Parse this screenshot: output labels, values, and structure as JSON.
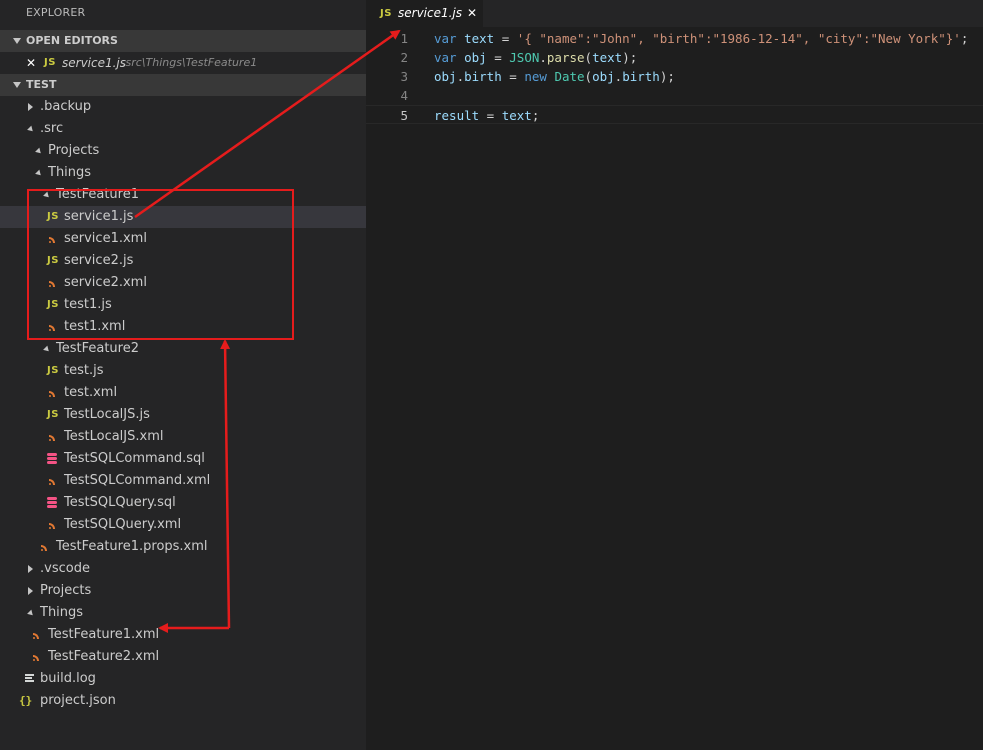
{
  "explorer": {
    "title": "EXPLORER",
    "open_editors": {
      "header": "OPEN EDITORS",
      "items": [
        {
          "icon": "JS",
          "name": "service1.js",
          "path": ".src\\Things\\TestFeature1",
          "close": "✕"
        }
      ]
    },
    "project": {
      "header": "TEST",
      "tree": [
        {
          "label": ".backup",
          "type": "folder",
          "state": "closed",
          "depth": 1
        },
        {
          "label": ".src",
          "type": "folder",
          "state": "open",
          "depth": 1
        },
        {
          "label": "Projects",
          "type": "folder",
          "state": "open",
          "depth": 2
        },
        {
          "label": "Things",
          "type": "folder",
          "state": "open",
          "depth": 2
        },
        {
          "label": "TestFeature1",
          "type": "folder",
          "state": "open",
          "depth": 3
        },
        {
          "label": "service1.js",
          "type": "js",
          "depth": 4,
          "selected": true
        },
        {
          "label": "service1.xml",
          "type": "xml",
          "depth": 4
        },
        {
          "label": "service2.js",
          "type": "js",
          "depth": 4
        },
        {
          "label": "service2.xml",
          "type": "xml",
          "depth": 4
        },
        {
          "label": "test1.js",
          "type": "js",
          "depth": 4
        },
        {
          "label": "test1.xml",
          "type": "xml",
          "depth": 4
        },
        {
          "label": "TestFeature2",
          "type": "folder",
          "state": "open",
          "depth": 3
        },
        {
          "label": "test.js",
          "type": "js",
          "depth": 4
        },
        {
          "label": "test.xml",
          "type": "xml",
          "depth": 4
        },
        {
          "label": "TestLocalJS.js",
          "type": "js",
          "depth": 4
        },
        {
          "label": "TestLocalJS.xml",
          "type": "xml",
          "depth": 4
        },
        {
          "label": "TestSQLCommand.sql",
          "type": "sql",
          "depth": 4
        },
        {
          "label": "TestSQLCommand.xml",
          "type": "xml",
          "depth": 4
        },
        {
          "label": "TestSQLQuery.sql",
          "type": "sql",
          "depth": 4
        },
        {
          "label": "TestSQLQuery.xml",
          "type": "xml",
          "depth": 4
        },
        {
          "label": "TestFeature1.props.xml",
          "type": "xml",
          "depth": 3
        },
        {
          "label": ".vscode",
          "type": "folder",
          "state": "closed",
          "depth": 1
        },
        {
          "label": "Projects",
          "type": "folder",
          "state": "closed",
          "depth": 1
        },
        {
          "label": "Things",
          "type": "folder",
          "state": "open",
          "depth": 1
        },
        {
          "label": "TestFeature1.xml",
          "type": "xml",
          "depth": 2
        },
        {
          "label": "TestFeature2.xml",
          "type": "xml",
          "depth": 2
        },
        {
          "label": "build.log",
          "type": "log",
          "depth": 1
        },
        {
          "label": "project.json",
          "type": "json",
          "depth": 1
        }
      ]
    }
  },
  "editor": {
    "tab": {
      "icon": "JS",
      "name": "service1.js",
      "close": "✕"
    },
    "lines": [
      {
        "num": "1",
        "tokens": [
          {
            "t": "var",
            "c": "kw"
          },
          {
            "t": " "
          },
          {
            "t": "text",
            "c": "vr"
          },
          {
            "t": " = "
          },
          {
            "t": "'{ \"name\":\"John\", \"birth\":\"1986-12-14\", \"city\":\"New York\"}'",
            "c": "st"
          },
          {
            "t": ";"
          }
        ]
      },
      {
        "num": "2",
        "tokens": [
          {
            "t": "var",
            "c": "kw"
          },
          {
            "t": " "
          },
          {
            "t": "obj",
            "c": "vr"
          },
          {
            "t": " = "
          },
          {
            "t": "JSON",
            "c": "cls"
          },
          {
            "t": "."
          },
          {
            "t": "parse",
            "c": "fn"
          },
          {
            "t": "("
          },
          {
            "t": "text",
            "c": "vr"
          },
          {
            "t": ");"
          }
        ]
      },
      {
        "num": "3",
        "tokens": [
          {
            "t": "obj",
            "c": "vr"
          },
          {
            "t": "."
          },
          {
            "t": "birth",
            "c": "vr"
          },
          {
            "t": " = "
          },
          {
            "t": "new",
            "c": "kw"
          },
          {
            "t": " "
          },
          {
            "t": "Date",
            "c": "cls"
          },
          {
            "t": "("
          },
          {
            "t": "obj",
            "c": "vr"
          },
          {
            "t": "."
          },
          {
            "t": "birth",
            "c": "vr"
          },
          {
            "t": ");"
          }
        ]
      },
      {
        "num": "4",
        "tokens": []
      },
      {
        "num": "5",
        "current": true,
        "tokens": [
          {
            "t": "result",
            "c": "vr"
          },
          {
            "t": " = "
          },
          {
            "t": "text",
            "c": "vr"
          },
          {
            "t": ";"
          }
        ]
      }
    ]
  },
  "colors": {
    "annotation": "#e51c1c",
    "js_icon": "#cbcb41",
    "xml_icon": "#e37933",
    "sql_icon": "#f55385"
  }
}
